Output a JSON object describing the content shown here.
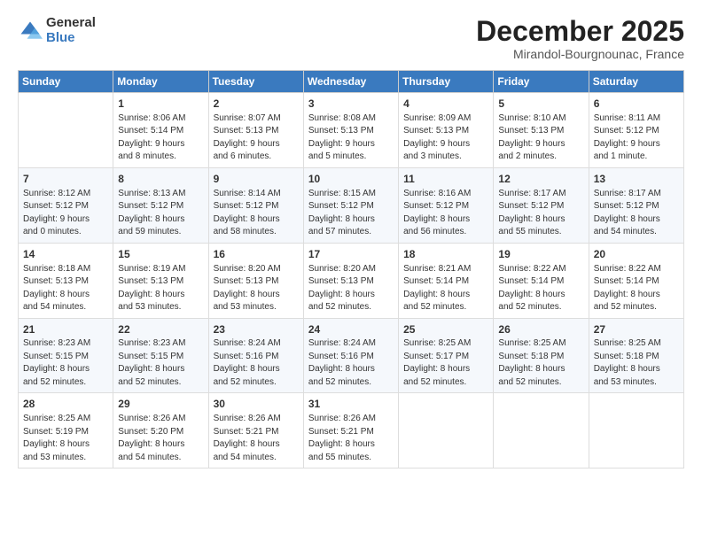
{
  "logo": {
    "general": "General",
    "blue": "Blue"
  },
  "header": {
    "month_title": "December 2025",
    "subtitle": "Mirandol-Bourgnounac, France"
  },
  "days_of_week": [
    "Sunday",
    "Monday",
    "Tuesday",
    "Wednesday",
    "Thursday",
    "Friday",
    "Saturday"
  ],
  "weeks": [
    [
      {
        "day": "",
        "info": ""
      },
      {
        "day": "1",
        "info": "Sunrise: 8:06 AM\nSunset: 5:14 PM\nDaylight: 9 hours\nand 8 minutes."
      },
      {
        "day": "2",
        "info": "Sunrise: 8:07 AM\nSunset: 5:13 PM\nDaylight: 9 hours\nand 6 minutes."
      },
      {
        "day": "3",
        "info": "Sunrise: 8:08 AM\nSunset: 5:13 PM\nDaylight: 9 hours\nand 5 minutes."
      },
      {
        "day": "4",
        "info": "Sunrise: 8:09 AM\nSunset: 5:13 PM\nDaylight: 9 hours\nand 3 minutes."
      },
      {
        "day": "5",
        "info": "Sunrise: 8:10 AM\nSunset: 5:13 PM\nDaylight: 9 hours\nand 2 minutes."
      },
      {
        "day": "6",
        "info": "Sunrise: 8:11 AM\nSunset: 5:12 PM\nDaylight: 9 hours\nand 1 minute."
      }
    ],
    [
      {
        "day": "7",
        "info": "Sunrise: 8:12 AM\nSunset: 5:12 PM\nDaylight: 9 hours\nand 0 minutes."
      },
      {
        "day": "8",
        "info": "Sunrise: 8:13 AM\nSunset: 5:12 PM\nDaylight: 8 hours\nand 59 minutes."
      },
      {
        "day": "9",
        "info": "Sunrise: 8:14 AM\nSunset: 5:12 PM\nDaylight: 8 hours\nand 58 minutes."
      },
      {
        "day": "10",
        "info": "Sunrise: 8:15 AM\nSunset: 5:12 PM\nDaylight: 8 hours\nand 57 minutes."
      },
      {
        "day": "11",
        "info": "Sunrise: 8:16 AM\nSunset: 5:12 PM\nDaylight: 8 hours\nand 56 minutes."
      },
      {
        "day": "12",
        "info": "Sunrise: 8:17 AM\nSunset: 5:12 PM\nDaylight: 8 hours\nand 55 minutes."
      },
      {
        "day": "13",
        "info": "Sunrise: 8:17 AM\nSunset: 5:12 PM\nDaylight: 8 hours\nand 54 minutes."
      }
    ],
    [
      {
        "day": "14",
        "info": "Sunrise: 8:18 AM\nSunset: 5:13 PM\nDaylight: 8 hours\nand 54 minutes."
      },
      {
        "day": "15",
        "info": "Sunrise: 8:19 AM\nSunset: 5:13 PM\nDaylight: 8 hours\nand 53 minutes."
      },
      {
        "day": "16",
        "info": "Sunrise: 8:20 AM\nSunset: 5:13 PM\nDaylight: 8 hours\nand 53 minutes."
      },
      {
        "day": "17",
        "info": "Sunrise: 8:20 AM\nSunset: 5:13 PM\nDaylight: 8 hours\nand 52 minutes."
      },
      {
        "day": "18",
        "info": "Sunrise: 8:21 AM\nSunset: 5:14 PM\nDaylight: 8 hours\nand 52 minutes."
      },
      {
        "day": "19",
        "info": "Sunrise: 8:22 AM\nSunset: 5:14 PM\nDaylight: 8 hours\nand 52 minutes."
      },
      {
        "day": "20",
        "info": "Sunrise: 8:22 AM\nSunset: 5:14 PM\nDaylight: 8 hours\nand 52 minutes."
      }
    ],
    [
      {
        "day": "21",
        "info": "Sunrise: 8:23 AM\nSunset: 5:15 PM\nDaylight: 8 hours\nand 52 minutes."
      },
      {
        "day": "22",
        "info": "Sunrise: 8:23 AM\nSunset: 5:15 PM\nDaylight: 8 hours\nand 52 minutes."
      },
      {
        "day": "23",
        "info": "Sunrise: 8:24 AM\nSunset: 5:16 PM\nDaylight: 8 hours\nand 52 minutes."
      },
      {
        "day": "24",
        "info": "Sunrise: 8:24 AM\nSunset: 5:16 PM\nDaylight: 8 hours\nand 52 minutes."
      },
      {
        "day": "25",
        "info": "Sunrise: 8:25 AM\nSunset: 5:17 PM\nDaylight: 8 hours\nand 52 minutes."
      },
      {
        "day": "26",
        "info": "Sunrise: 8:25 AM\nSunset: 5:18 PM\nDaylight: 8 hours\nand 52 minutes."
      },
      {
        "day": "27",
        "info": "Sunrise: 8:25 AM\nSunset: 5:18 PM\nDaylight: 8 hours\nand 53 minutes."
      }
    ],
    [
      {
        "day": "28",
        "info": "Sunrise: 8:25 AM\nSunset: 5:19 PM\nDaylight: 8 hours\nand 53 minutes."
      },
      {
        "day": "29",
        "info": "Sunrise: 8:26 AM\nSunset: 5:20 PM\nDaylight: 8 hours\nand 54 minutes."
      },
      {
        "day": "30",
        "info": "Sunrise: 8:26 AM\nSunset: 5:21 PM\nDaylight: 8 hours\nand 54 minutes."
      },
      {
        "day": "31",
        "info": "Sunrise: 8:26 AM\nSunset: 5:21 PM\nDaylight: 8 hours\nand 55 minutes."
      },
      {
        "day": "",
        "info": ""
      },
      {
        "day": "",
        "info": ""
      },
      {
        "day": "",
        "info": ""
      }
    ]
  ]
}
